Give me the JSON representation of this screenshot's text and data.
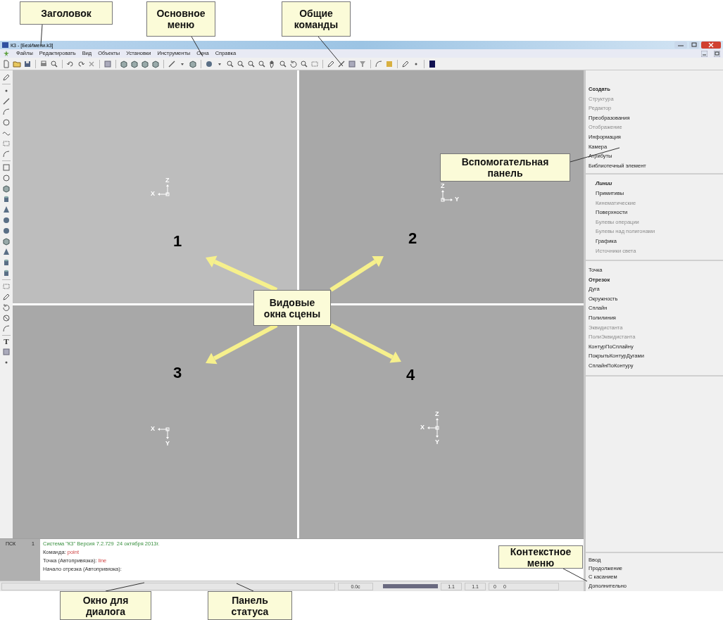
{
  "callouts": [
    {
      "text": "Заголовок"
    },
    {
      "text": "Основное меню"
    },
    {
      "text": "Общие команды"
    },
    {
      "text": "Вспомогательная панель"
    },
    {
      "text": "Видовые окна сцены"
    },
    {
      "text": "Контекстное меню"
    },
    {
      "text": "Окно для диалога"
    },
    {
      "text": "Панель статуса"
    }
  ],
  "window": {
    "title": "К3 - [БезИмени.k3]"
  },
  "menu": [
    "Файлы",
    "Редактировать",
    "Вид",
    "Объекты",
    "Установки",
    "Инструменты",
    "Окна",
    "Справка"
  ],
  "left_toolbar": {
    "text_tool": "T"
  },
  "viewports": [
    {
      "label": "1",
      "axes": [
        {
          "label": "X",
          "kind": "left"
        },
        {
          "label": "Z",
          "kind": "up"
        }
      ]
    },
    {
      "label": "2",
      "axes": [
        {
          "label": "Z",
          "kind": "up"
        },
        {
          "label": "Y",
          "kind": "right"
        }
      ]
    },
    {
      "label": "3",
      "axes": [
        {
          "label": "X",
          "kind": "left"
        },
        {
          "label": "Y",
          "kind": "down"
        }
      ]
    },
    {
      "label": "4",
      "axes": [
        {
          "label": "X",
          "kind": "left"
        },
        {
          "label": "Z",
          "kind": "up"
        },
        {
          "label": "Y",
          "kind": "down"
        }
      ]
    }
  ],
  "panel": {
    "sections": [
      {
        "kind": "commands",
        "items": [
          {
            "label": "Создать",
            "disabled": false,
            "selected": true
          },
          {
            "label": "Структура",
            "disabled": true,
            "selected": false
          },
          {
            "label": "Редактор",
            "disabled": true,
            "selected": false
          },
          {
            "label": "Преобразования",
            "disabled": false,
            "selected": false
          },
          {
            "label": "Отображение",
            "disabled": true,
            "selected": false
          },
          {
            "label": "Информация",
            "disabled": false,
            "selected": false
          },
          {
            "label": "Камера",
            "disabled": false,
            "selected": false
          },
          {
            "label": "Атрибуты",
            "disabled": false,
            "selected": false
          },
          {
            "label": "Библиотечный элемент",
            "disabled": false,
            "selected": false
          }
        ]
      },
      {
        "kind": "categories",
        "items": [
          {
            "label": "Линии",
            "disabled": false,
            "selected": true
          },
          {
            "label": "Примитивы",
            "disabled": false,
            "selected": false
          },
          {
            "label": "Кинематические",
            "disabled": true,
            "selected": false
          },
          {
            "label": "Поверхности",
            "disabled": false,
            "selected": false
          },
          {
            "label": "Булевы операции",
            "disabled": true,
            "selected": false
          },
          {
            "label": "Булевы над полигонами",
            "disabled": true,
            "selected": false
          },
          {
            "label": "Графика",
            "disabled": false,
            "selected": false
          },
          {
            "label": "Источники света",
            "disabled": true,
            "selected": false
          }
        ]
      },
      {
        "kind": "tools",
        "items": [
          {
            "label": "Точка",
            "disabled": false,
            "selected": false
          },
          {
            "label": "Отрезок",
            "disabled": false,
            "selected": true
          },
          {
            "label": "Дуга",
            "disabled": false,
            "selected": false
          },
          {
            "label": "Окружность",
            "disabled": false,
            "selected": false
          },
          {
            "label": "Сплайн",
            "disabled": false,
            "selected": false
          },
          {
            "label": "Полилиния",
            "disabled": false,
            "selected": false
          },
          {
            "label": "Эквидистанта",
            "disabled": true,
            "selected": false
          },
          {
            "label": "ПолиЭквидистанта",
            "disabled": true,
            "selected": false
          },
          {
            "label": "КонтурПоСплайну",
            "disabled": false,
            "selected": false
          },
          {
            "label": "ПокрытьКонтурДугами",
            "disabled": false,
            "selected": false
          },
          {
            "label": "СплайнПоКонтуру",
            "disabled": false,
            "selected": false
          }
        ]
      },
      {
        "kind": "context",
        "items": [
          {
            "label": "Ввод",
            "disabled": false,
            "selected": false
          },
          {
            "label": "Продолжение",
            "disabled": false,
            "selected": false
          },
          {
            "label": "С касанием",
            "disabled": false,
            "selected": false
          },
          {
            "label": "Дополнительно",
            "disabled": false,
            "selected": false
          }
        ]
      }
    ]
  },
  "dialog": {
    "psk_label": "ПСК",
    "psk_number": "1",
    "lines": [
      {
        "segments": [
          {
            "kind": "info",
            "text": "Система \"К3\" Версия 7.2.729  24 октября 2013г."
          }
        ]
      },
      {
        "segments": [
          {
            "kind": "prompt",
            "text": "Команда: "
          },
          {
            "kind": "input",
            "text": "point"
          }
        ]
      },
      {
        "segments": [
          {
            "kind": "prompt",
            "text": "Точка (Автопривязка): "
          },
          {
            "kind": "input",
            "text": "line"
          }
        ]
      },
      {
        "segments": [
          {
            "kind": "prompt",
            "text": "Начало отрезка (Автопривязка):"
          }
        ]
      }
    ]
  },
  "status_bar": {
    "time": "0.0с",
    "progress": {
      "level": 1
    },
    "cells": [
      "1.1",
      "1.1",
      "0",
      "0"
    ]
  }
}
